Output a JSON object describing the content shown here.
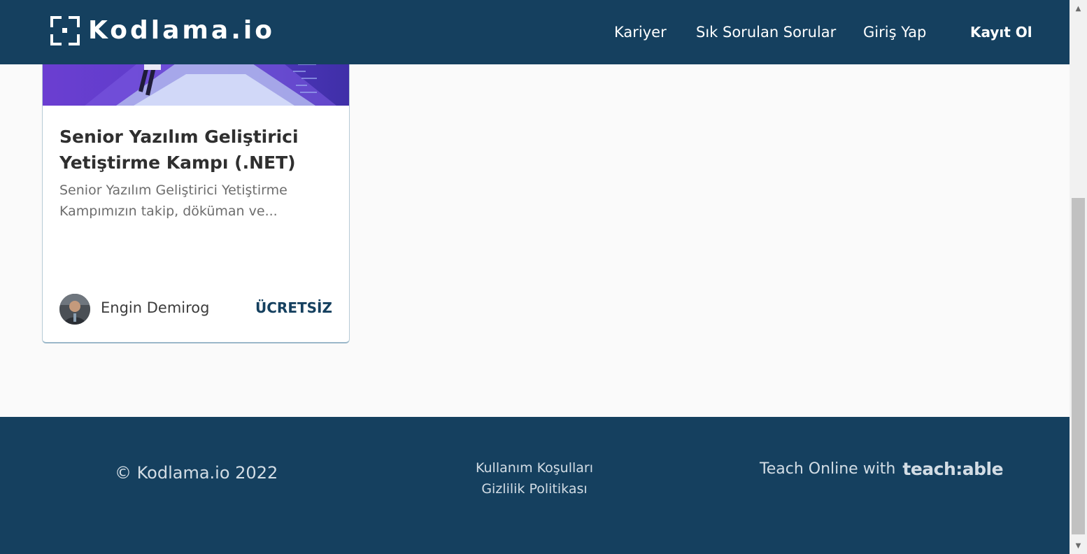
{
  "header": {
    "logo_text": "Kodlama.io",
    "nav": [
      {
        "label": "Kariyer"
      },
      {
        "label": "Sık Sorulan Sorular"
      },
      {
        "label": "Giriş Yap"
      },
      {
        "label": "Kayıt Ol"
      }
    ]
  },
  "course": {
    "title": "Senior Yazılım Geliştirici Yetiştirme Kampı (.NET)",
    "description": "Senior Yazılım Geliştirici Yetiştirme Kampımızın takip, döküman ve...",
    "author": "Engin Demirog",
    "price": "ÜCRETSİZ"
  },
  "footer": {
    "copyright": "© Kodlama.io 2022",
    "links": [
      {
        "label": "Kullanım Koşulları"
      },
      {
        "label": "Gizlilik Politikası"
      }
    ],
    "teach_text": "Teach Online with",
    "teach_brand": "teach:able"
  },
  "colors": {
    "primary": "#15405f",
    "background": "#fafafa",
    "card_border": "#b7cbd6"
  },
  "icons": {
    "scroll_up": "arrow-up-icon",
    "scroll_down": "arrow-down-icon",
    "logo": "kodlama-bracket-logo"
  }
}
